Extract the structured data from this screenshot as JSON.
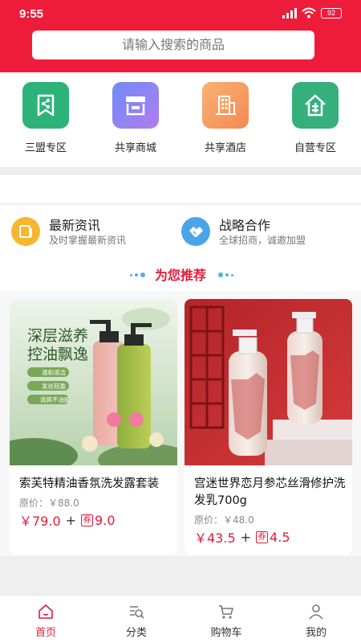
{
  "status_bar": {
    "time": "9:55",
    "battery": "92"
  },
  "search": {
    "placeholder": "请输入搜索的商品"
  },
  "categories": [
    {
      "label": "三盟专区",
      "icon": "share-bookmark-icon",
      "color": "#2db37a"
    },
    {
      "label": "共享商城",
      "icon": "storefront-icon",
      "color": "#8a7cf0"
    },
    {
      "label": "共享酒店",
      "icon": "hotel-building-icon",
      "color": "#f7a15e"
    },
    {
      "label": "自营专区",
      "icon": "house-icon",
      "color": "#35b07d"
    }
  ],
  "info": [
    {
      "title": "最新资讯",
      "subtitle": "及时掌握最新资讯",
      "icon": "news-icon",
      "color": "#f6b62f"
    },
    {
      "title": "战略合作",
      "subtitle": "全球招商，诚邀加盟",
      "icon": "handshake-icon",
      "color": "#4aa4ea"
    }
  ],
  "recommend": {
    "title": "为您推荐"
  },
  "products": [
    {
      "name": "索芙特精油香氛洗发露套装",
      "original_price": "原价：￥88.0",
      "price": "￥79.0",
      "plus": "+",
      "coupon_badge": "券",
      "coupon_value": "9.0",
      "image_text": {
        "line1": "深层滋养",
        "line2": "控油飘逸",
        "tags": [
          "温和清洁",
          "发丝轻盈",
          "清爽不油腻"
        ]
      }
    },
    {
      "name": "宫迷世界恋月参芯丝滑修护洗发乳700g",
      "original_price": "原价：￥48.0",
      "price": "￥43.5",
      "plus": "+",
      "coupon_badge": "券",
      "coupon_value": "4.5"
    }
  ],
  "tabs": [
    {
      "label": "首页",
      "icon": "home-icon",
      "active": true
    },
    {
      "label": "分类",
      "icon": "category-search-icon",
      "active": false
    },
    {
      "label": "购物车",
      "icon": "cart-icon",
      "active": false
    },
    {
      "label": "我的",
      "icon": "user-icon",
      "active": false
    }
  ],
  "colors": {
    "brand_red": "#ee1c3a",
    "price_red": "#e41b37",
    "accent_blue": "#55aee6"
  }
}
